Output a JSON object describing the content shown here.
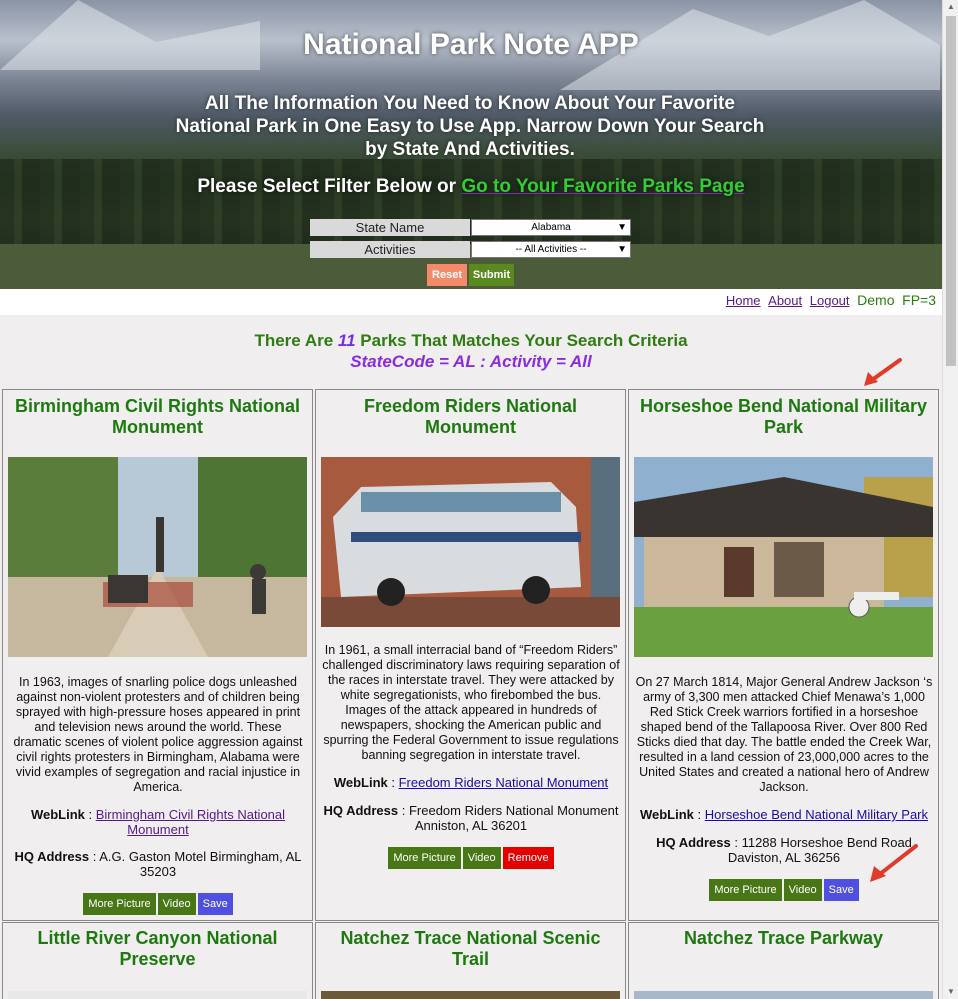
{
  "hero": {
    "title": "National Park Note APP",
    "subtitle": "All The Information You Need to Know About Your Favorite National Park in One Easy to Use App. Narrow Down Your Search by State And Activities.",
    "filter_prefix": "Please Select Filter Below or ",
    "favorites_link": "Go to Your Favorite Parks Page"
  },
  "filters": {
    "state_label": "State Name",
    "state_value": "Alabama",
    "activity_label": "Activities",
    "activity_value": "-- All Activities --",
    "reset_label": "Reset",
    "submit_label": "Submit"
  },
  "nav": {
    "home": "Home",
    "about": "About",
    "logout": "Logout",
    "user": "Demo",
    "fp": "FP=3"
  },
  "results": {
    "prefix": "There Are ",
    "count": "11",
    "suffix": " Parks That Matches Your Search Criteria",
    "criteria": "StateCode = AL : Activity = All"
  },
  "parks": [
    {
      "title": "Birmingham Civil Rights National Monument",
      "description": "In 1963, images of snarling police dogs unleashed against non-violent protesters and of children being sprayed with high-pressure hoses appeared in print and television news around the world. These dramatic scenes of violent police aggression against civil rights protesters in Birmingham, Alabama were vivid examples of segregation and racial injustice in America.",
      "weblink_label": "WebLink",
      "weblink": "Birmingham Civil Rights National Monument",
      "hq_label": "HQ Address",
      "hq": "A.G. Gaston Motel Birmingham, AL 35203",
      "more_picture": "More Picture",
      "video": "Video",
      "action": "Save"
    },
    {
      "title": "Freedom Riders National Monument",
      "description": "In 1961, a small interracial band of “Freedom Riders” challenged discriminatory laws requiring separation of the races in interstate travel. They were attacked by white segregationists, who firebombed the bus. Images of the attack appeared in hundreds of newspapers, shocking the American public and spurring the Federal Government to issue regulations banning segregation in interstate travel.",
      "weblink_label": "WebLink",
      "weblink": "Freedom Riders National Monument",
      "hq_label": "HQ Address",
      "hq": "Freedom Riders National Monument Anniston, AL 36201",
      "more_picture": "More Picture",
      "video": "Video",
      "action": "Remove"
    },
    {
      "title": "Horseshoe Bend National Military Park",
      "description": "On 27 March 1814, Major General Andrew Jackson ‘s army of 3,300 men attacked Chief Menawa’s 1,000 Red Stick Creek warriors fortified in a horseshoe shaped bend of the Tallapoosa River. Over 800 Red Sticks died that day. The battle ended the Creek War, resulted in a land cession of 23,000,000 acres to the United States and created a national hero of Andrew Jackson.",
      "weblink_label": "WebLink",
      "weblink": "Horseshoe Bend National Military Park",
      "hq_label": "HQ Address",
      "hq": "11288 Horseshoe Bend Road Daviston, AL 36256",
      "more_picture": "More Picture",
      "video": "Video",
      "action": "Save"
    },
    {
      "title": "Little River Canyon National Preserve"
    },
    {
      "title": "Natchez Trace National Scenic Trail"
    },
    {
      "title": "Natchez Trace Parkway"
    }
  ],
  "colors": {
    "title_green": "#1e7a10",
    "button_green": "#497717",
    "save_blue": "#5050e0",
    "remove_red": "#e50000",
    "annotation_arrow": "#e03a2a"
  }
}
